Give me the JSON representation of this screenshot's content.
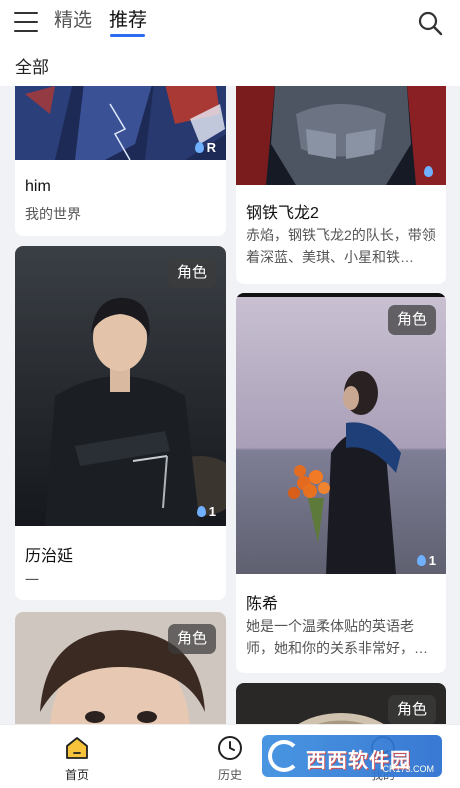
{
  "header": {
    "tabs": [
      {
        "label": "精选",
        "active": false
      },
      {
        "label": "推荐",
        "active": true
      }
    ],
    "accent_color": "#2d6bf0"
  },
  "filter": {
    "label": "全部"
  },
  "cards": [
    {
      "title": "him",
      "desc": "我的世界",
      "badge": "",
      "count": "R"
    },
    {
      "title": "钢铁飞龙2",
      "desc": "赤焰，钢铁飞龙2的队长，带领着深蓝、美琪、小星和铁…",
      "badge": "",
      "count": ""
    },
    {
      "title": "历治延",
      "desc": "一",
      "badge": "角色",
      "count": "1"
    },
    {
      "title": "陈希",
      "desc": "她是一个温柔体贴的英语老师，她和你的关系非常好，…",
      "badge": "角色",
      "count": "1"
    },
    {
      "title": "",
      "desc": "",
      "badge": "角色",
      "count": ""
    },
    {
      "title": "",
      "desc": "",
      "badge": "角色",
      "count": ""
    }
  ],
  "bottom_nav": [
    {
      "label": "首页",
      "icon": "home-icon",
      "active": true
    },
    {
      "label": "历史",
      "icon": "clock-icon",
      "active": false
    },
    {
      "label": "我的",
      "icon": "profile-icon",
      "active": false
    }
  ],
  "watermark": {
    "text": "西西软件园",
    "sub": "CR173.COM"
  }
}
